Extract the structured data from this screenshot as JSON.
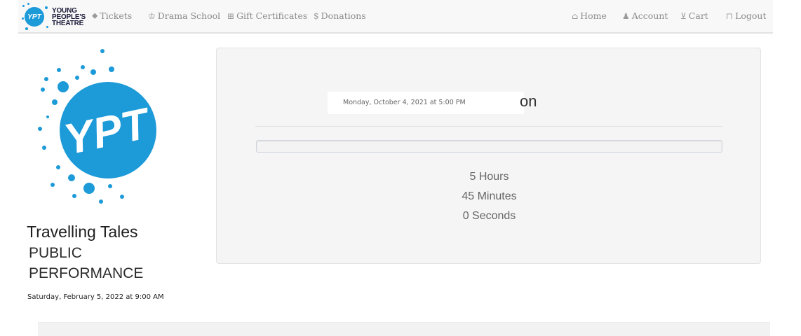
{
  "navbar": {
    "logo": {
      "mark_text": "YPT",
      "line1": "YOUNG",
      "line2": "PEOPLE'S",
      "line3": "THEATRE"
    },
    "left_items": [
      {
        "icon": "tag-icon",
        "glyph": "⬥",
        "label": "Tickets"
      },
      {
        "icon": "tie-icon",
        "glyph": "♔",
        "label": "Drama School"
      },
      {
        "icon": "gift-icon",
        "glyph": "⊞",
        "label": "Gift Certificates"
      },
      {
        "icon": "dollar-icon",
        "glyph": "$",
        "label": "Donations"
      }
    ],
    "right_items": [
      {
        "icon": "home-icon",
        "glyph": "⌂",
        "label": "Home"
      },
      {
        "icon": "user-icon",
        "glyph": "♟",
        "label": "Account"
      },
      {
        "icon": "cart-icon",
        "glyph": "⊻",
        "label": "Cart"
      },
      {
        "icon": "lock-icon",
        "glyph": "⊓",
        "label": "Logout"
      }
    ]
  },
  "event": {
    "logo_text": "YPT",
    "title": "Travelling Tales",
    "subtitle_line1": "PUBLIC",
    "subtitle_line2": "PERFORMANCE",
    "date": "Saturday, February 5, 2022 at 9:00 AM"
  },
  "panel": {
    "overlay_date": "Monday, October 4, 2021 at 5:00 PM",
    "heading_fragment": "on",
    "progress_percent": 0,
    "countdown": {
      "hours": "5 Hours",
      "minutes": "45 Minutes",
      "seconds": "0 Seconds"
    }
  },
  "colors": {
    "brand_blue": "#1d9ad8",
    "navbar_bg": "#f8f8f8",
    "panel_bg": "#f5f5f5"
  }
}
